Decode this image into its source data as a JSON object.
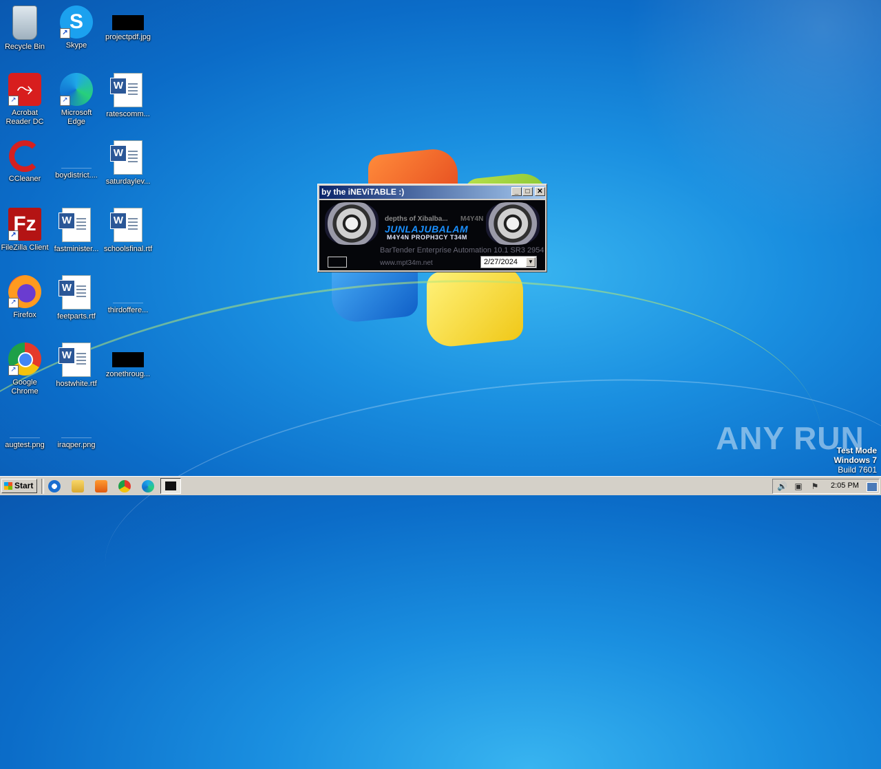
{
  "desktop": {
    "icons": [
      {
        "label": "Recycle Bin"
      },
      {
        "label": "Skype"
      },
      {
        "label": "projectpdf.jpg"
      },
      {
        "label": "Acrobat Reader DC"
      },
      {
        "label": "Microsoft Edge"
      },
      {
        "label": "ratescomm..."
      },
      {
        "label": "CCleaner"
      },
      {
        "label": "boydistrict...."
      },
      {
        "label": "saturdaylev..."
      },
      {
        "label": "FileZilla Client"
      },
      {
        "label": "fastminister..."
      },
      {
        "label": "schoolsfinal.rtf"
      },
      {
        "label": "Firefox"
      },
      {
        "label": "feetparts.rtf"
      },
      {
        "label": "thirdoffere..."
      },
      {
        "label": "Google Chrome"
      },
      {
        "label": "hostwhite.rtf"
      },
      {
        "label": "zonethroug..."
      },
      {
        "label": "augtest.png"
      },
      {
        "label": "iraqper.png"
      }
    ]
  },
  "dialog": {
    "title": "by the iNEViTABLE :)",
    "banner_line1": "depths of Xibalba...",
    "banner_line1b": "M4Y4N",
    "banner_line2": "JUNLAJUBALAM",
    "banner_line3": "M4Y4N PROPH3CY T34M",
    "product": "BarTender Enterprise Automation 10.1 SR3 2954",
    "website": "www.mpt34m.net",
    "date_value": "2/27/2024"
  },
  "watermark": {
    "brand": "ANY RUN",
    "test_mode": "Test Mode",
    "os": "Windows 7",
    "build": "Build 7601"
  },
  "taskbar": {
    "start_label": "Start",
    "clock": "2:05 PM"
  }
}
